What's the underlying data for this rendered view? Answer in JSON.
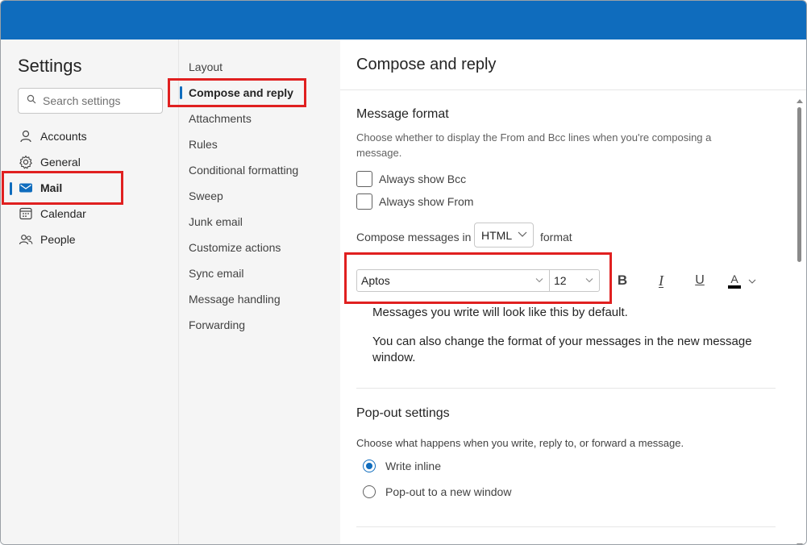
{
  "settings": {
    "title": "Settings",
    "search_placeholder": "Search settings"
  },
  "categories": [
    {
      "label": "Accounts",
      "icon": "person-icon"
    },
    {
      "label": "General",
      "icon": "gear-icon"
    },
    {
      "label": "Mail",
      "icon": "mail-icon",
      "active": true
    },
    {
      "label": "Calendar",
      "icon": "calendar-icon"
    },
    {
      "label": "People",
      "icon": "people-icon"
    }
  ],
  "mail_subsections": [
    {
      "label": "Layout"
    },
    {
      "label": "Compose and reply",
      "active": true
    },
    {
      "label": "Attachments"
    },
    {
      "label": "Rules"
    },
    {
      "label": "Conditional formatting"
    },
    {
      "label": "Sweep"
    },
    {
      "label": "Junk email"
    },
    {
      "label": "Customize actions"
    },
    {
      "label": "Sync email"
    },
    {
      "label": "Message handling"
    },
    {
      "label": "Forwarding"
    }
  ],
  "pane": {
    "title": "Compose and reply",
    "message_format": {
      "title": "Message format",
      "description": "Choose whether to display the From and Bcc lines when you're composing a message.",
      "always_show_bcc": "Always show Bcc",
      "always_show_from": "Always show From",
      "compose_prefix": "Compose messages in",
      "compose_format": "HTML",
      "compose_suffix": "format"
    },
    "font_toolbar": {
      "font": "Aptos",
      "size": "12",
      "bold": "B",
      "italic": "I",
      "underline": "U",
      "font_color": "A"
    },
    "preview": {
      "line1": "Messages you write will look like this by default.",
      "line2": "You can also change the format of your messages in the new message window."
    },
    "popout": {
      "title": "Pop-out settings",
      "description": "Choose what happens when you write, reply to, or forward a message.",
      "option1": "Write inline",
      "option2": "Pop-out to a new window",
      "selected": "Write inline"
    }
  },
  "colors": {
    "accent": "#0f6cbd",
    "highlight": "#e02020",
    "topbar": "#0f6cbd"
  }
}
